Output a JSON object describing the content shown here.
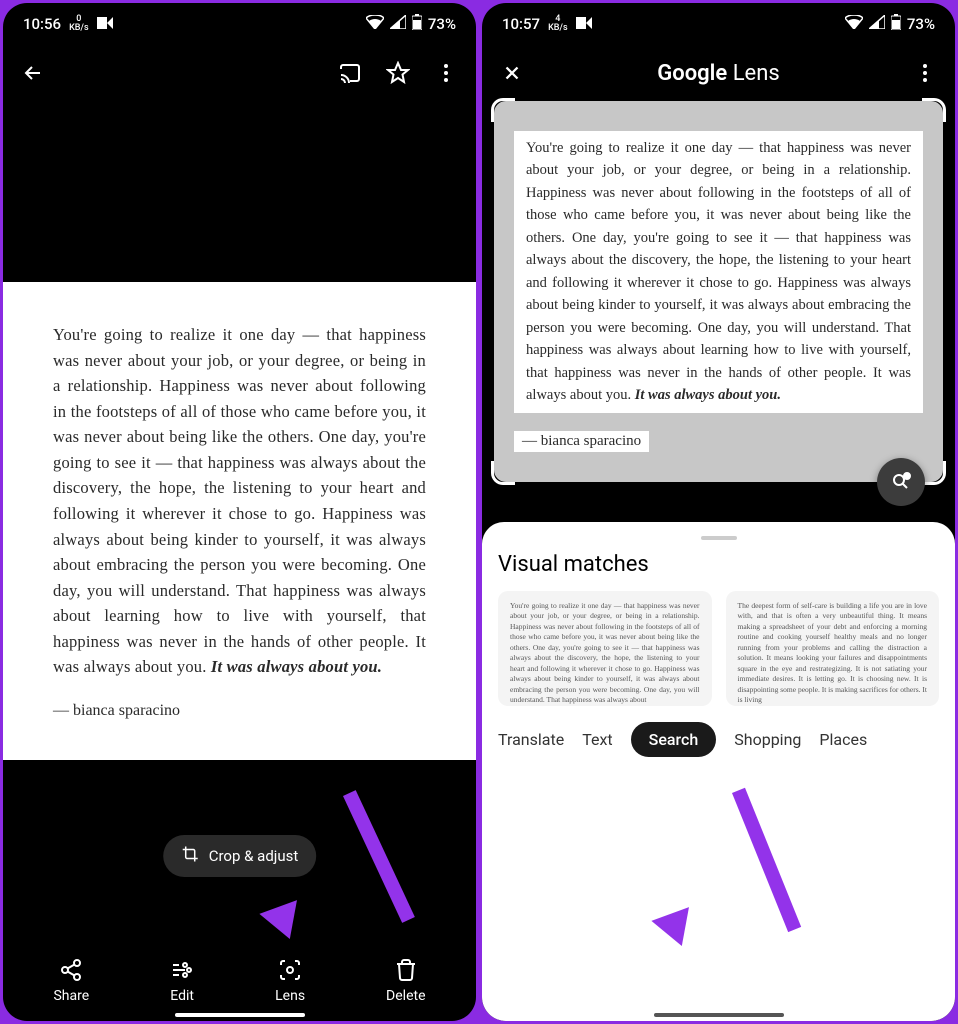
{
  "left": {
    "status": {
      "time": "10:56",
      "net_num": "0",
      "net_unit": "KB/s",
      "battery": "73%"
    },
    "quote": "You're going to realize it one day  — that happiness was never about your job, or your degree, or being in a relationship. Happiness was never about following in the footsteps of all of those who came before you, it was never about being like the others. One day, you're going to see it — that happiness was always about the discovery, the hope, the listening to your heart and following it wherever it chose to go. Happiness was always about being kinder to yourself, it was always about embracing the person you were becoming. One day, you will understand. That happiness was always about learning how to live with yourself, that happiness was never in the hands of other people. It was always about you. ",
    "quote_emphasis": "It was always about you.",
    "author": "— bianca sparacino",
    "crop_label": "Crop & adjust",
    "actions": {
      "share": "Share",
      "edit": "Edit",
      "lens": "Lens",
      "delete": "Delete"
    }
  },
  "right": {
    "status": {
      "time": "10:57",
      "net_num": "4",
      "net_unit": "KB/s",
      "battery": "73%"
    },
    "title_a": "Google",
    "title_b": " Lens",
    "quote": "You're going to realize it one day  — that happiness was never about your job, or your degree, or being in a relationship. Happiness was never about following in the footsteps of all of those who came before you, it was never about being like the others. One day, you're going to see it — that happiness was always about the discovery, the hope, the listening to your heart and following it wherever it chose to go. Happiness was always about being kinder to yourself, it was always about embracing the person you were becoming. One day, you will understand. That happiness was always about learning how to live with yourself, that happiness was never in the hands of other people. It was always about you. ",
    "quote_emphasis": "It was always about you.",
    "author": "— bianca sparacino",
    "sheet_title": "Visual matches",
    "match1": "You're going to realize it one day — that happiness was never about your job, or your degree, or being in a relationship. Happiness was never about following in the footsteps of all of those who came before you, it was never about being like the others. One day, you're going to see it — that happiness was always about the discovery, the hope, the listening to your heart and following it wherever it chose to go. Happiness was always about being kinder to yourself, it was always about embracing the person you were becoming. One day, you will understand. That happiness was always about",
    "match2": "The deepest form of self-care is building a life you are in love with, and that is often a very unbeautiful thing. It means making a spreadsheet of your debt and enforcing a morning routine and cooking yourself healthy meals and no longer running from your problems and calling the distraction a solution. It means looking your failures and disappointments square in the eye and restrategizing. It is not satiating your immediate desires. It is letting go. It is choosing new. It is disappointing some people. It is making sacrifices for others. It is living",
    "tabs": {
      "translate": "Translate",
      "text": "Text",
      "search": "Search",
      "shopping": "Shopping",
      "places": "Places"
    }
  }
}
